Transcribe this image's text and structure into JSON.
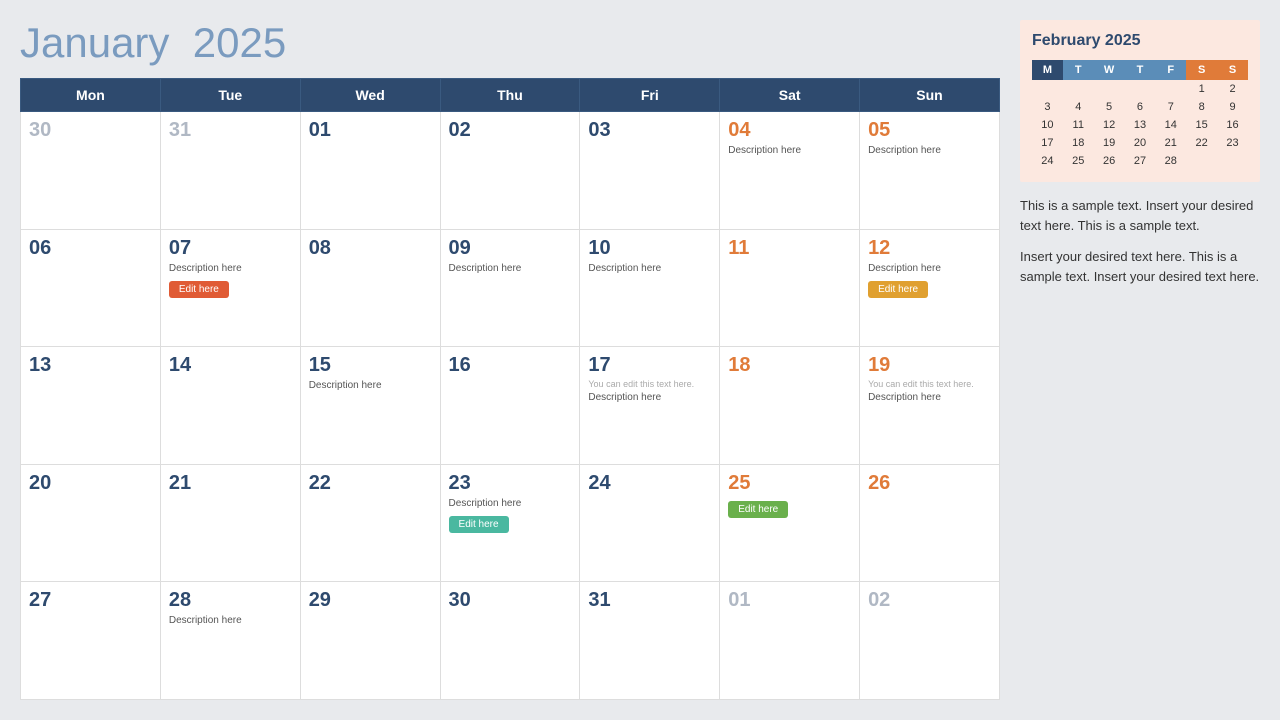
{
  "header": {
    "month": "January",
    "year": "2025"
  },
  "weekdays": [
    "Mon",
    "Tue",
    "Wed",
    "Thu",
    "Fri",
    "Sat",
    "Sun"
  ],
  "weeks": [
    [
      {
        "day": "30",
        "otherMonth": true
      },
      {
        "day": "31",
        "otherMonth": true
      },
      {
        "day": "01"
      },
      {
        "day": "02"
      },
      {
        "day": "03"
      },
      {
        "day": "04",
        "weekend": true,
        "desc": "Description here"
      },
      {
        "day": "05",
        "weekend": true,
        "desc": "Description here"
      }
    ],
    [
      {
        "day": "06"
      },
      {
        "day": "07",
        "desc": "Description here",
        "editBtn": "red",
        "editLabel": "Edit here"
      },
      {
        "day": "08"
      },
      {
        "day": "09",
        "desc": "Description here"
      },
      {
        "day": "10",
        "desc": "Description here"
      },
      {
        "day": "11",
        "weekend": true
      },
      {
        "day": "12",
        "weekend": true,
        "desc": "Description here",
        "editBtn": "orange",
        "editLabel": "Edit here"
      }
    ],
    [
      {
        "day": "13"
      },
      {
        "day": "14"
      },
      {
        "day": "15",
        "desc": "Description here"
      },
      {
        "day": "16"
      },
      {
        "day": "17",
        "note": "You can edit this text here.",
        "desc": "Description here"
      },
      {
        "day": "18",
        "weekend": true
      },
      {
        "day": "19",
        "weekend": true,
        "note": "You can edit this text here.",
        "desc": "Description here"
      }
    ],
    [
      {
        "day": "20"
      },
      {
        "day": "21"
      },
      {
        "day": "22"
      },
      {
        "day": "23",
        "desc": "Description here",
        "editBtn": "teal",
        "editLabel": "Edit here"
      },
      {
        "day": "24"
      },
      {
        "day": "25",
        "weekend": true,
        "editBtn": "green",
        "editLabel": "Edit here"
      },
      {
        "day": "26",
        "weekend": true
      }
    ],
    [
      {
        "day": "27"
      },
      {
        "day": "28",
        "desc": "Description here"
      },
      {
        "day": "29"
      },
      {
        "day": "30"
      },
      {
        "day": "31"
      },
      {
        "day": "01",
        "otherMonth": true
      },
      {
        "day": "02",
        "otherMonth": true
      }
    ]
  ],
  "sidebar": {
    "miniCal": {
      "title": "February 2025",
      "headers": [
        "M",
        "T",
        "W",
        "T",
        "F",
        "S",
        "S"
      ],
      "weeks": [
        [
          "",
          "",
          "",
          "",
          "",
          "1",
          "2"
        ],
        [
          "3",
          "4",
          "5",
          "6",
          "7",
          "8",
          "9"
        ],
        [
          "10",
          "11",
          "12",
          "13",
          "14",
          "15",
          "16"
        ],
        [
          "17",
          "18",
          "19",
          "20",
          "21",
          "22",
          "23"
        ],
        [
          "24",
          "25",
          "26",
          "27",
          "28",
          "",
          ""
        ]
      ]
    },
    "text1": "This is a sample text. Insert your desired text here. This is a sample text.",
    "text2": "Insert your desired text here. This is a sample text. Insert your desired text here."
  }
}
